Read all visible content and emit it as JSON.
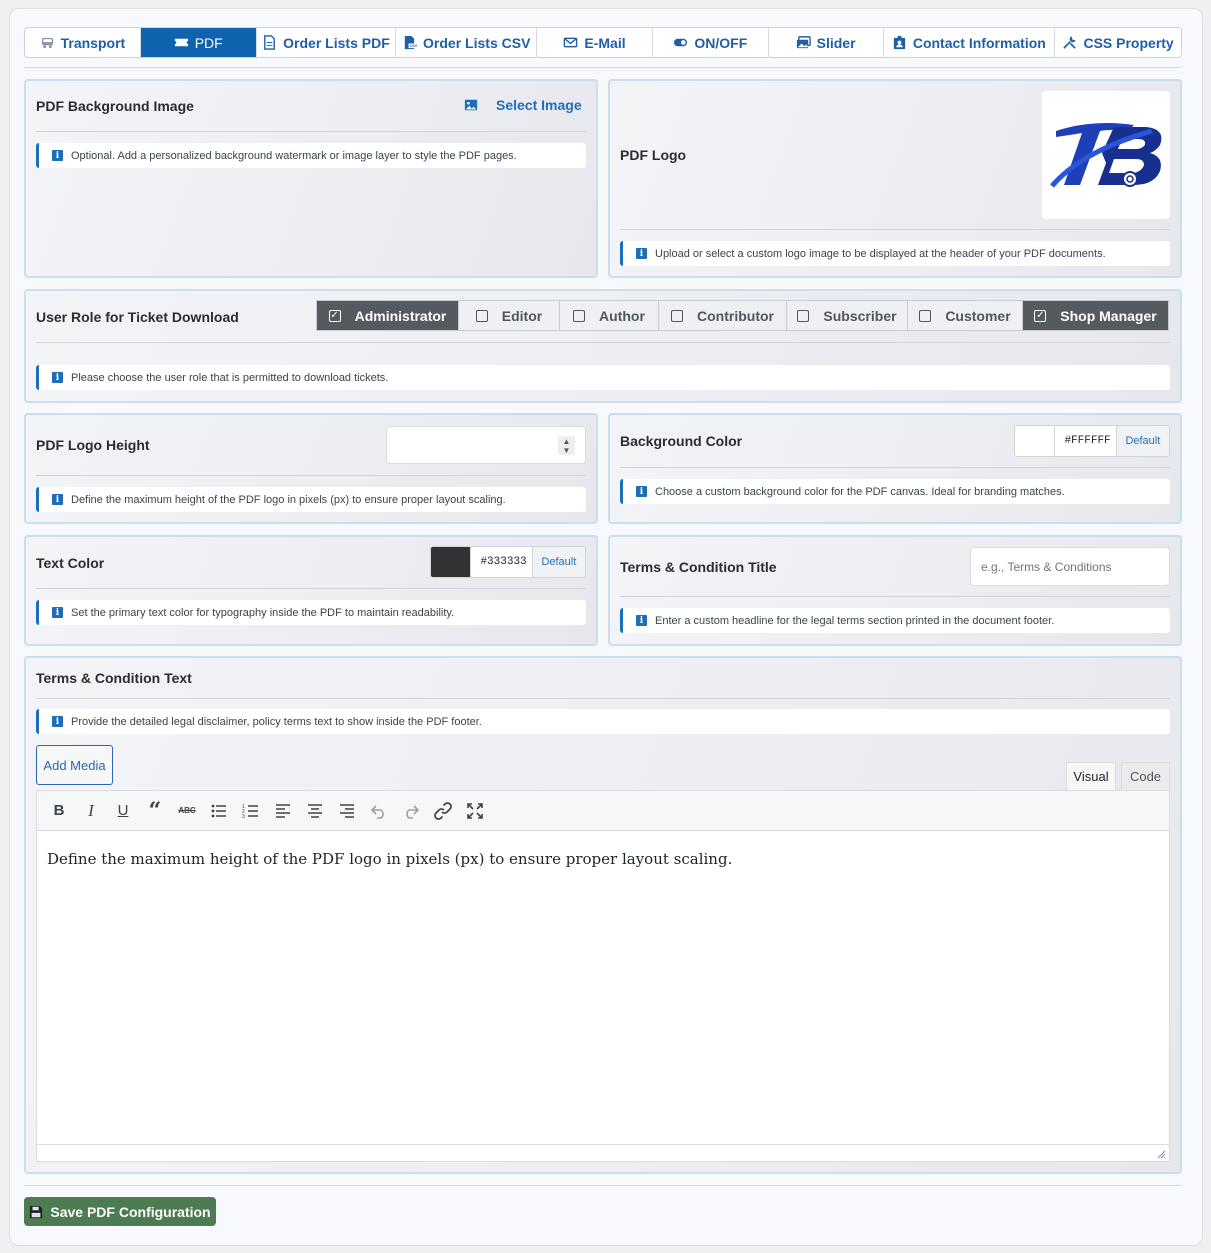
{
  "tabs": [
    {
      "label": "Transport",
      "icon": "bus-icon"
    },
    {
      "label": "PDF",
      "icon": "ticket-icon"
    },
    {
      "label": "Order Lists PDF",
      "icon": "file-icon"
    },
    {
      "label": "Order Lists CSV",
      "icon": "file-csv-icon"
    },
    {
      "label": "E-Mail",
      "icon": "envelope-icon"
    },
    {
      "label": "ON/OFF",
      "icon": "toggle-icon"
    },
    {
      "label": "Slider",
      "icon": "images-icon"
    },
    {
      "label": "Contact Information",
      "icon": "contact-card-icon"
    },
    {
      "label": "CSS Property",
      "icon": "tools-icon"
    }
  ],
  "active_tab": "PDF",
  "bg_image": {
    "title": "PDF Background Image",
    "select_label": "Select Image",
    "note": "Optional. Add a personalized background watermark or image layer to style the PDF pages."
  },
  "logo": {
    "title": "PDF Logo",
    "logo_text": "TB",
    "note": "Upload or select a custom logo image to be displayed at the header of your PDF documents."
  },
  "roles": {
    "title": "User Role for Ticket Download",
    "items": [
      {
        "label": "Administrator",
        "checked": true
      },
      {
        "label": "Editor",
        "checked": false
      },
      {
        "label": "Author",
        "checked": false
      },
      {
        "label": "Contributor",
        "checked": false
      },
      {
        "label": "Subscriber",
        "checked": false
      },
      {
        "label": "Customer",
        "checked": false
      },
      {
        "label": "Shop Manager",
        "checked": true
      }
    ],
    "note": "Please choose the user role that is permitted to download tickets."
  },
  "logo_height": {
    "title": "PDF Logo Height",
    "value": "",
    "note": "Define the maximum height of the PDF logo in pixels (px) to ensure proper layout scaling."
  },
  "bg_color": {
    "title": "Background Color",
    "swatch": "#ffffff",
    "hex": "#FFFFFF",
    "default_label": "Default",
    "note": "Choose a custom background color for the PDF canvas. Ideal for branding matches."
  },
  "text_color": {
    "title": "Text Color",
    "swatch": "#333333",
    "hex": "#333333",
    "default_label": "Default",
    "note": "Set the primary text color for typography inside the PDF to maintain readability."
  },
  "terms_title": {
    "title": "Terms & Condition Title",
    "placeholder": "e.g., Terms & Conditions",
    "note": "Enter a custom headline for the legal terms section printed in the document footer."
  },
  "terms_text": {
    "title": "Terms & Condition Text",
    "note": "Provide the detailed legal disclaimer, policy terms text to show inside the PDF footer.",
    "add_media_label": "Add Media",
    "visual_tab": "Visual",
    "code_tab": "Code",
    "content": "Define the maximum height of the PDF logo in pixels (px) to ensure proper layout scaling."
  },
  "save_label": "Save PDF Configuration",
  "colors": {
    "accent": "#0f62ae",
    "save": "#4e7c52",
    "panel_border": "#c9dff0"
  }
}
